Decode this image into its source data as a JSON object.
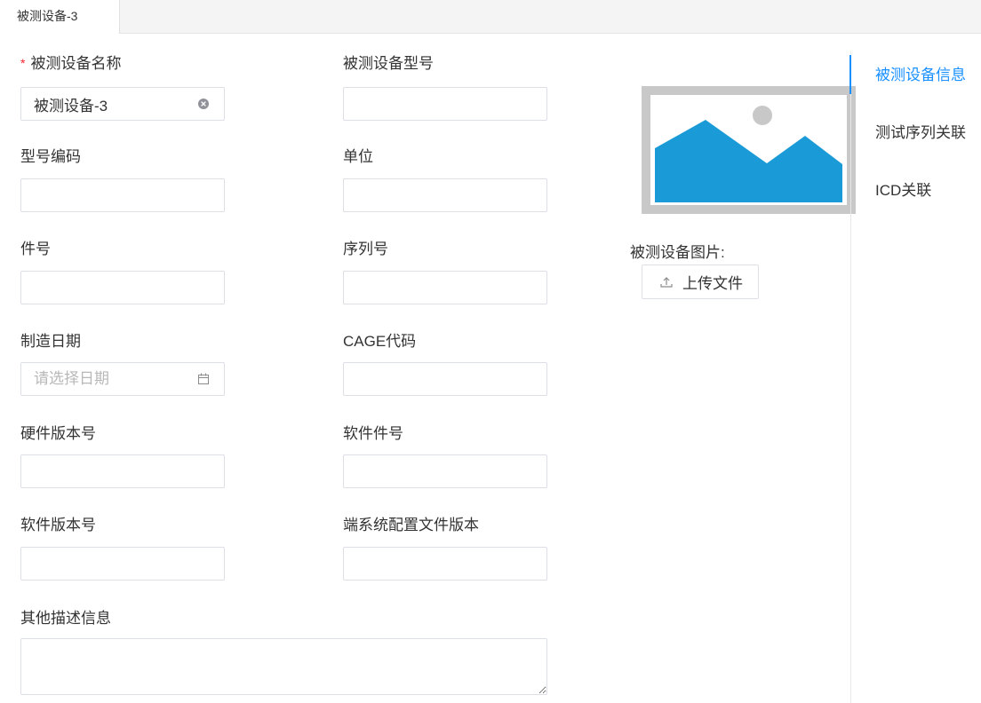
{
  "tabs": [
    {
      "label": "被测设备-3",
      "active": true
    }
  ],
  "form": {
    "required_mark": "*",
    "device_name": {
      "label": "被测设备名称",
      "value": "被测设备-3",
      "required": true,
      "icon": "clear-icon"
    },
    "device_model": {
      "label": "被测设备型号",
      "value": ""
    },
    "model_code": {
      "label": "型号编码",
      "value": ""
    },
    "unit": {
      "label": "单位",
      "value": ""
    },
    "part_number": {
      "label": "件号",
      "value": ""
    },
    "serial_number": {
      "label": "序列号",
      "value": ""
    },
    "manufacture_date": {
      "label": "制造日期",
      "value": "",
      "placeholder": "请选择日期",
      "icon": "calendar-icon"
    },
    "cage_code": {
      "label": "CAGE代码",
      "value": ""
    },
    "hardware_version": {
      "label": "硬件版本号",
      "value": ""
    },
    "software_part_number": {
      "label": "软件件号",
      "value": ""
    },
    "software_version": {
      "label": "软件版本号",
      "value": ""
    },
    "es_config_version": {
      "label": "端系统配置文件版本",
      "value": ""
    },
    "description": {
      "label": "其他描述信息",
      "value": ""
    }
  },
  "image": {
    "label": "被测设备图片:",
    "placeholder_icon": "image-placeholder-icon",
    "upload_button": {
      "label": "上传文件",
      "icon": "upload-icon"
    }
  },
  "side_nav": {
    "items": [
      {
        "label": "被测设备信息",
        "active": true
      },
      {
        "label": "测试序列关联",
        "active": false
      },
      {
        "label": "ICD关联",
        "active": false
      }
    ]
  },
  "colors": {
    "accent": "#1890ff",
    "required": "#f5222d",
    "text": "#333333",
    "border": "#dcdfe6",
    "image_blue": "#1a9bd7",
    "image_frame": "#c8c8c8"
  }
}
